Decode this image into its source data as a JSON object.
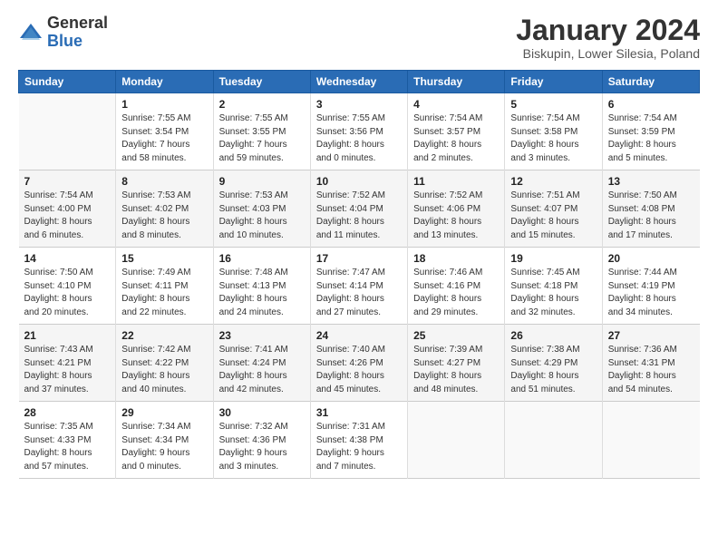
{
  "logo": {
    "general": "General",
    "blue": "Blue"
  },
  "title": "January 2024",
  "subtitle": "Biskupin, Lower Silesia, Poland",
  "days_header": [
    "Sunday",
    "Monday",
    "Tuesday",
    "Wednesday",
    "Thursday",
    "Friday",
    "Saturday"
  ],
  "weeks": [
    [
      {
        "num": "",
        "info": ""
      },
      {
        "num": "1",
        "info": "Sunrise: 7:55 AM\nSunset: 3:54 PM\nDaylight: 7 hours\nand 58 minutes."
      },
      {
        "num": "2",
        "info": "Sunrise: 7:55 AM\nSunset: 3:55 PM\nDaylight: 7 hours\nand 59 minutes."
      },
      {
        "num": "3",
        "info": "Sunrise: 7:55 AM\nSunset: 3:56 PM\nDaylight: 8 hours\nand 0 minutes."
      },
      {
        "num": "4",
        "info": "Sunrise: 7:54 AM\nSunset: 3:57 PM\nDaylight: 8 hours\nand 2 minutes."
      },
      {
        "num": "5",
        "info": "Sunrise: 7:54 AM\nSunset: 3:58 PM\nDaylight: 8 hours\nand 3 minutes."
      },
      {
        "num": "6",
        "info": "Sunrise: 7:54 AM\nSunset: 3:59 PM\nDaylight: 8 hours\nand 5 minutes."
      }
    ],
    [
      {
        "num": "7",
        "info": "Sunrise: 7:54 AM\nSunset: 4:00 PM\nDaylight: 8 hours\nand 6 minutes."
      },
      {
        "num": "8",
        "info": "Sunrise: 7:53 AM\nSunset: 4:02 PM\nDaylight: 8 hours\nand 8 minutes."
      },
      {
        "num": "9",
        "info": "Sunrise: 7:53 AM\nSunset: 4:03 PM\nDaylight: 8 hours\nand 10 minutes."
      },
      {
        "num": "10",
        "info": "Sunrise: 7:52 AM\nSunset: 4:04 PM\nDaylight: 8 hours\nand 11 minutes."
      },
      {
        "num": "11",
        "info": "Sunrise: 7:52 AM\nSunset: 4:06 PM\nDaylight: 8 hours\nand 13 minutes."
      },
      {
        "num": "12",
        "info": "Sunrise: 7:51 AM\nSunset: 4:07 PM\nDaylight: 8 hours\nand 15 minutes."
      },
      {
        "num": "13",
        "info": "Sunrise: 7:50 AM\nSunset: 4:08 PM\nDaylight: 8 hours\nand 17 minutes."
      }
    ],
    [
      {
        "num": "14",
        "info": "Sunrise: 7:50 AM\nSunset: 4:10 PM\nDaylight: 8 hours\nand 20 minutes."
      },
      {
        "num": "15",
        "info": "Sunrise: 7:49 AM\nSunset: 4:11 PM\nDaylight: 8 hours\nand 22 minutes."
      },
      {
        "num": "16",
        "info": "Sunrise: 7:48 AM\nSunset: 4:13 PM\nDaylight: 8 hours\nand 24 minutes."
      },
      {
        "num": "17",
        "info": "Sunrise: 7:47 AM\nSunset: 4:14 PM\nDaylight: 8 hours\nand 27 minutes."
      },
      {
        "num": "18",
        "info": "Sunrise: 7:46 AM\nSunset: 4:16 PM\nDaylight: 8 hours\nand 29 minutes."
      },
      {
        "num": "19",
        "info": "Sunrise: 7:45 AM\nSunset: 4:18 PM\nDaylight: 8 hours\nand 32 minutes."
      },
      {
        "num": "20",
        "info": "Sunrise: 7:44 AM\nSunset: 4:19 PM\nDaylight: 8 hours\nand 34 minutes."
      }
    ],
    [
      {
        "num": "21",
        "info": "Sunrise: 7:43 AM\nSunset: 4:21 PM\nDaylight: 8 hours\nand 37 minutes."
      },
      {
        "num": "22",
        "info": "Sunrise: 7:42 AM\nSunset: 4:22 PM\nDaylight: 8 hours\nand 40 minutes."
      },
      {
        "num": "23",
        "info": "Sunrise: 7:41 AM\nSunset: 4:24 PM\nDaylight: 8 hours\nand 42 minutes."
      },
      {
        "num": "24",
        "info": "Sunrise: 7:40 AM\nSunset: 4:26 PM\nDaylight: 8 hours\nand 45 minutes."
      },
      {
        "num": "25",
        "info": "Sunrise: 7:39 AM\nSunset: 4:27 PM\nDaylight: 8 hours\nand 48 minutes."
      },
      {
        "num": "26",
        "info": "Sunrise: 7:38 AM\nSunset: 4:29 PM\nDaylight: 8 hours\nand 51 minutes."
      },
      {
        "num": "27",
        "info": "Sunrise: 7:36 AM\nSunset: 4:31 PM\nDaylight: 8 hours\nand 54 minutes."
      }
    ],
    [
      {
        "num": "28",
        "info": "Sunrise: 7:35 AM\nSunset: 4:33 PM\nDaylight: 8 hours\nand 57 minutes."
      },
      {
        "num": "29",
        "info": "Sunrise: 7:34 AM\nSunset: 4:34 PM\nDaylight: 9 hours\nand 0 minutes."
      },
      {
        "num": "30",
        "info": "Sunrise: 7:32 AM\nSunset: 4:36 PM\nDaylight: 9 hours\nand 3 minutes."
      },
      {
        "num": "31",
        "info": "Sunrise: 7:31 AM\nSunset: 4:38 PM\nDaylight: 9 hours\nand 7 minutes."
      },
      {
        "num": "",
        "info": ""
      },
      {
        "num": "",
        "info": ""
      },
      {
        "num": "",
        "info": ""
      }
    ]
  ]
}
